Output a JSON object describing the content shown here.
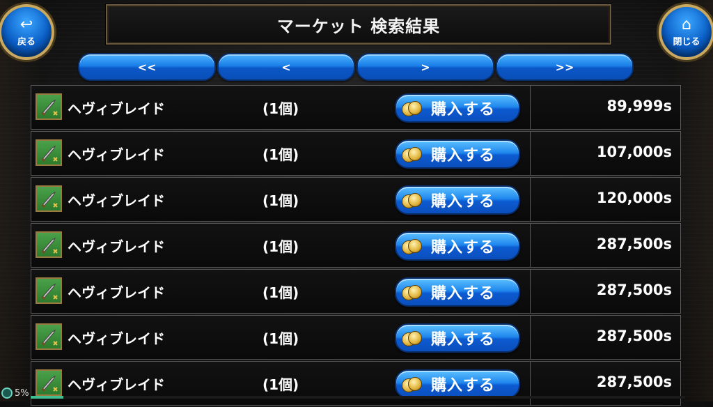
{
  "header": {
    "title": "マーケット 検索結果",
    "back_label": "戻る",
    "close_label": "閉じる"
  },
  "pager": {
    "first": "<<",
    "prev": "<",
    "next": ">",
    "last": ">>"
  },
  "listings": [
    {
      "name": "ヘヴィブレイド",
      "qty": "(1個)",
      "buy": "購入する",
      "price": "89,999s"
    },
    {
      "name": "ヘヴィブレイド",
      "qty": "(1個)",
      "buy": "購入する",
      "price": "107,000s"
    },
    {
      "name": "ヘヴィブレイド",
      "qty": "(1個)",
      "buy": "購入する",
      "price": "120,000s"
    },
    {
      "name": "ヘヴィブレイド",
      "qty": "(1個)",
      "buy": "購入する",
      "price": "287,500s"
    },
    {
      "name": "ヘヴィブレイド",
      "qty": "(1個)",
      "buy": "購入する",
      "price": "287,500s"
    },
    {
      "name": "ヘヴィブレイド",
      "qty": "(1個)",
      "buy": "購入する",
      "price": "287,500s"
    },
    {
      "name": "ヘヴィブレイド",
      "qty": "(1個)",
      "buy": "購入する",
      "price": "287,500s"
    }
  ],
  "status": {
    "percent_text": "5%",
    "progress": 0.05
  },
  "icons": {
    "back": "undo-arrow-icon",
    "close": "home-icon",
    "item": "sword-icon",
    "buy": "coins-icon"
  },
  "colors": {
    "button_blue": "#1b7fe8",
    "frame_gold": "#c9a860",
    "item_icon_green": "#4aa24a"
  }
}
